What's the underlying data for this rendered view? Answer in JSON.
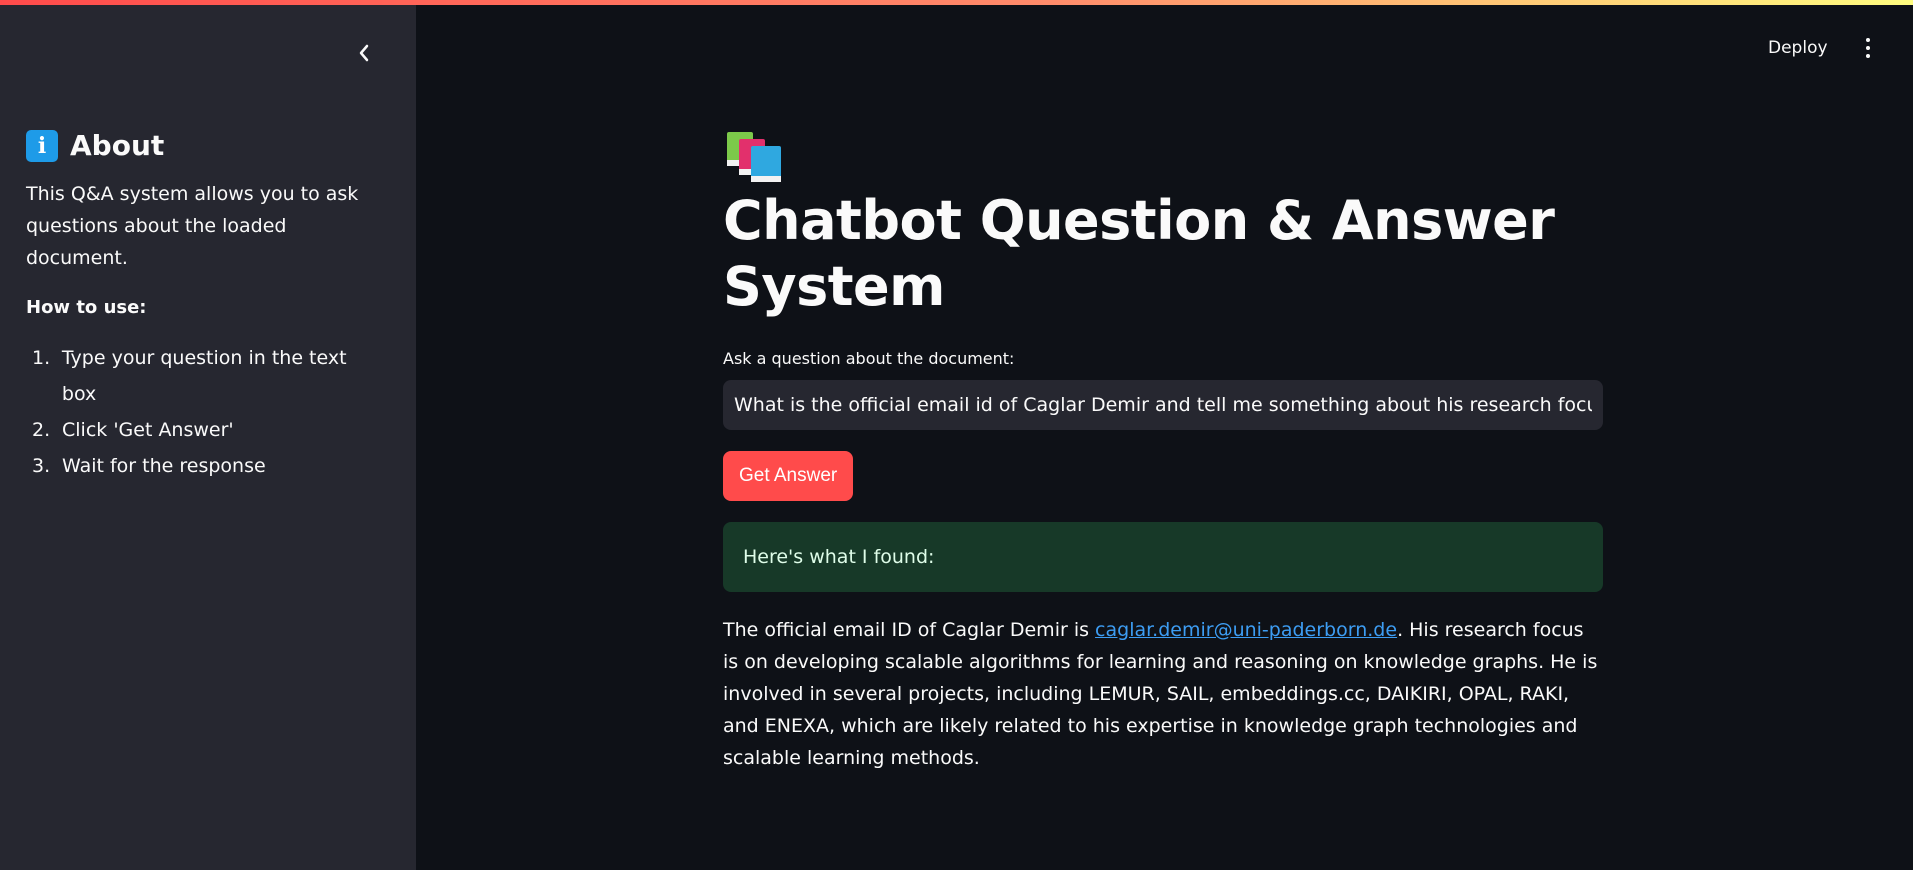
{
  "header": {
    "deploy_label": "Deploy",
    "menu_icon": "vertical-ellipsis-icon"
  },
  "sidebar": {
    "collapse_icon": "chevron-left-icon",
    "about_icon": "info-icon",
    "about_title": "About",
    "about_text": "This Q&A system allows you to ask questions about the loaded document.",
    "how_to_use": "How to use:",
    "steps": [
      {
        "num": "1.",
        "text": "Type your question in the text box"
      },
      {
        "num": "2.",
        "text": "Click 'Get Answer'"
      },
      {
        "num": "3.",
        "text": "Wait for the response"
      }
    ]
  },
  "main": {
    "title_icon": "books-icon",
    "title": "Chatbot Question & Answer System",
    "question_label": "Ask a question about the document:",
    "question_value": "What is the official email id of Caglar Demir and tell me something about his research focus.",
    "button_label": "Get Answer",
    "found_text": "Here's what I found:",
    "answer_prefix": "The official email ID of Caglar Demir is ",
    "answer_email": "caglar.demir@uni-paderborn.de",
    "answer_suffix": ". His research focus is on developing scalable algorithms for learning and reasoning on knowledge graphs. He is involved in several projects, including LEMUR, SAIL, embeddings.cc, DAIKIRI, OPAL, RAKI, and ENEXA, which are likely related to his expertise in knowledge graph technologies and scalable learning methods."
  },
  "colors": {
    "background": "#0e1117",
    "sidebar": "#262730",
    "accent": "#ff4b4b",
    "success_bg": "#173928",
    "link": "#3d9df3"
  }
}
